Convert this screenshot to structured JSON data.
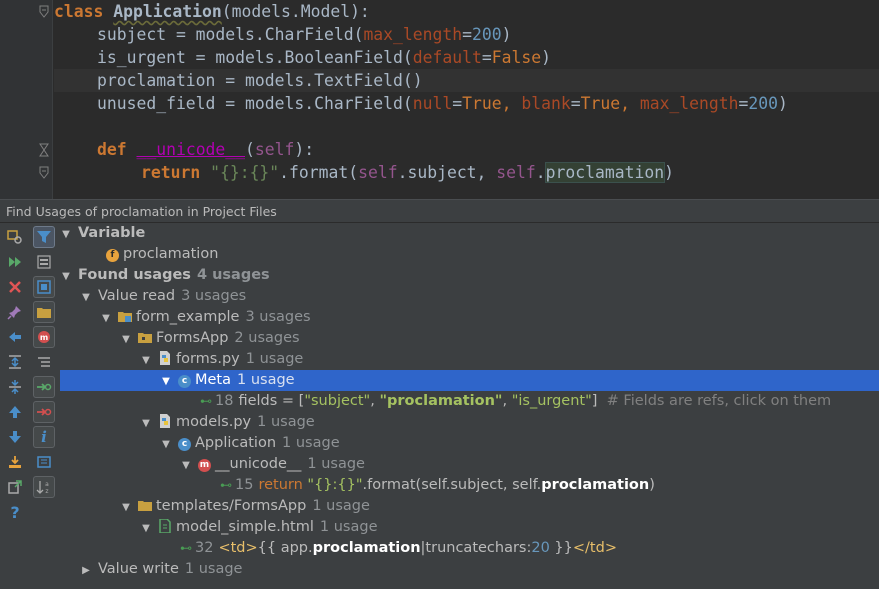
{
  "editor": {
    "line1": {
      "kw": "class",
      "name": "Application",
      "rest": "(models.Model):"
    },
    "line2": {
      "a": "subject = models.CharField(",
      "kw": "max_length",
      "eq": "=",
      "num": "200",
      "close": ")"
    },
    "line3": {
      "a": "is_urgent = models.BooleanField(",
      "kw": "default",
      "eq": "=",
      "val": "False",
      "close": ")"
    },
    "line4": {
      "a": "proclamation = models.TextField()"
    },
    "line5": {
      "a": "unused_field = models.CharField(",
      "kw1": "null",
      "eq1": "=",
      "v1": "True",
      "sep1": ", ",
      "kw2": "blank",
      "eq2": "=",
      "v2": "True",
      "sep2": ", ",
      "kw3": "max_length",
      "eq3": "=",
      "num": "200",
      "close": ")"
    },
    "line7": {
      "def": "def",
      "fn": "__unicode__",
      "open": "(",
      "self": "self",
      "close": "):"
    },
    "line8": {
      "ret": "return",
      "str": "\"{}:{}\"",
      "mid": ".format(",
      "self1": "self",
      ".subject": ".subject, ",
      "self2": "self",
      "dot": ".",
      "hit": "proclamation",
      "close": ")"
    }
  },
  "panel": {
    "title": "Find Usages of proclamation in Project Files"
  },
  "tree": {
    "variable": "Variable",
    "proclamation": "proclamation",
    "found": "Found usages",
    "found_count": "4 usages",
    "value_read": "Value read",
    "value_read_count": "3 usages",
    "form_example": "form_example",
    "form_example_count": "3 usages",
    "formsapp": "FormsApp",
    "formsapp_count": "2 usages",
    "forms_py": "forms.py",
    "forms_py_count": "1 usage",
    "meta": "Meta",
    "meta_count": "1 usage",
    "u1": {
      "line": "18",
      "a": "fields = [",
      "s1": "\"subject\"",
      "c1": ", ",
      "s2": "\"proclamation\"",
      "c2": ", ",
      "s3": "\"is_urgent\"",
      "c3": "]  ",
      "cmt": "# Fields are refs, click on them"
    },
    "models_py": "models.py",
    "models_py_count": "1 usage",
    "application": "Application",
    "application_count": "1 usage",
    "unicode": "__unicode__",
    "unicode_count": "1 usage",
    "u2": {
      "line": "15",
      "kw": "return",
      "str": "\"{}:{}\"",
      "a": ".format(self.subject, self.",
      "hit": "proclamation",
      "close": ")"
    },
    "templates": "templates/FormsApp",
    "templates_count": "1 usage",
    "model_simple": "model_simple.html",
    "model_simple_count": "1 usage",
    "u3": {
      "line": "32",
      "open": "<td>",
      "a": "{{ app.",
      "hit": "proclamation",
      "b": "|truncatechars:",
      "num": "20",
      "c": " }}",
      "close": "</td>"
    },
    "value_write": "Value write",
    "value_write_count": "1 usage"
  },
  "colors": {
    "selection": "#2f65ca",
    "background": "#2b2b2b",
    "panel": "#3c3f41"
  }
}
